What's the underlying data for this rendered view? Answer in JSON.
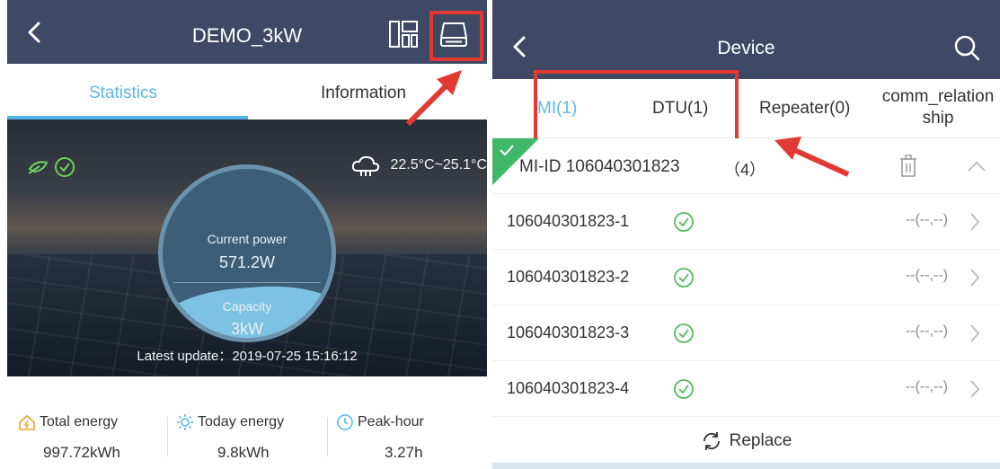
{
  "left_screen": {
    "header": {
      "title": "DEMO_3kW",
      "back_icon": "back-chevron-icon",
      "layout_icon": "dashboard-layout-icon",
      "device_icon": "device-gateway-icon"
    },
    "tabs": [
      {
        "label": "Statistics",
        "active": true
      },
      {
        "label": "Information",
        "active": false
      }
    ],
    "hero": {
      "status_icons": [
        "plant-wind-icon",
        "check-circle-icon"
      ],
      "weather": {
        "icon": "cloud-icon",
        "temp_range": "22.5°C~25.1°C"
      },
      "current_power_label": "Current power",
      "current_power_value": "571.2W",
      "capacity_label": "Capacity",
      "capacity_value": "3kW",
      "latest_update_label": "Latest update：",
      "latest_update_value": "2019-07-25 15:16:12"
    },
    "stats": [
      {
        "icon": "home-energy-icon",
        "label": "Total energy",
        "value": "997.72kWh"
      },
      {
        "icon": "sun-icon",
        "label": "Today energy",
        "value": "9.8kWh"
      },
      {
        "icon": "clock-icon",
        "label": "Peak-hour",
        "value": "3.27h"
      }
    ]
  },
  "right_screen": {
    "header": {
      "title": "Device",
      "back_icon": "back-chevron-icon",
      "search_icon": "search-icon"
    },
    "tabs": [
      {
        "label": "MI(1)",
        "active": true
      },
      {
        "label": "DTU(1)",
        "active": false
      },
      {
        "label": "Repeater(0)",
        "active": false
      },
      {
        "label_line1": "comm_relation",
        "label_line2": "ship",
        "active": false
      }
    ],
    "group": {
      "id_label": "MI-ID 106040301823",
      "count": "（4）",
      "delete_icon": "trash-icon",
      "collapse_icon": "chevron-up-icon"
    },
    "rows": [
      {
        "id": "106040301823-1",
        "status": "--(--,--)"
      },
      {
        "id": "106040301823-2",
        "status": "--(--,--)"
      },
      {
        "id": "106040301823-3",
        "status": "--(--,--)"
      },
      {
        "id": "106040301823-4",
        "status": "--(--,--)"
      }
    ],
    "replace_label": "Replace"
  },
  "colors": {
    "header_bg": "#3e4a65",
    "accent_blue": "#4fb3e8",
    "highlight_red": "#e23a32",
    "ok_green": "#4caf50"
  }
}
